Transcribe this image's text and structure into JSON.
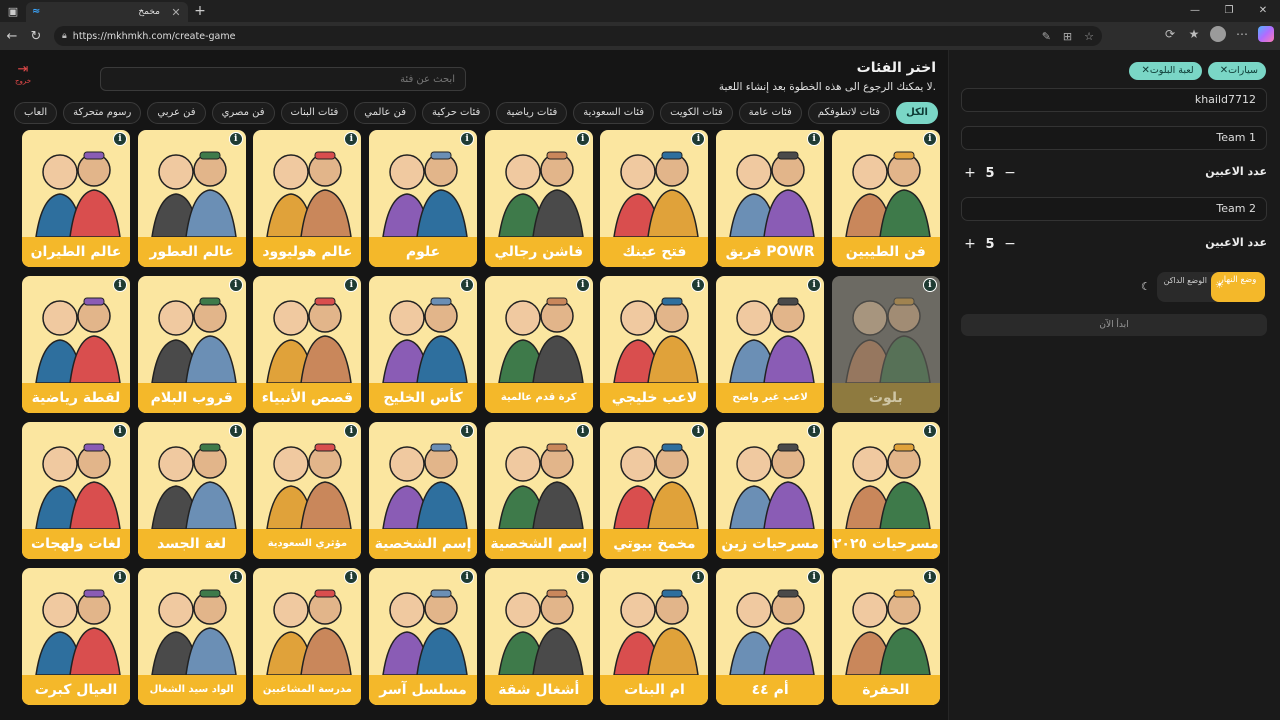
{
  "browser": {
    "tab_title": "مخمخ",
    "url": "https://mkhmkh.com/create-game",
    "minimize": "—",
    "maximize": "❐",
    "close": "✕",
    "new_tab": "+"
  },
  "main": {
    "exit_label": "خروج",
    "search_placeholder": "ابحث عن فئة",
    "title": "اختر الفئات",
    "subtitle": "لا يمكنك الرجوع الى هذه الخطوة بعد إنشاء اللعبة.",
    "chips": [
      {
        "label": "الكل",
        "active": true
      },
      {
        "label": "فئات لاتطوفكم",
        "active": false
      },
      {
        "label": "فئات عامة",
        "active": false
      },
      {
        "label": "فئات الكويت",
        "active": false
      },
      {
        "label": "فئات السعودية",
        "active": false
      },
      {
        "label": "فئات رياضية",
        "active": false
      },
      {
        "label": "فئات حركية",
        "active": false
      },
      {
        "label": "فن عالمي",
        "active": false
      },
      {
        "label": "فئات البنات",
        "active": false
      },
      {
        "label": "فن مصري",
        "active": false
      },
      {
        "label": "فن عربي",
        "active": false
      },
      {
        "label": "رسوم متحركة",
        "active": false
      },
      {
        "label": "العاب",
        "active": false
      }
    ],
    "cards": [
      {
        "label": "فن الطيبين",
        "icon": "two-men-portrait",
        "dim": false
      },
      {
        "label": "فريق POWR",
        "icon": "building-facade",
        "dim": false
      },
      {
        "label": "فتح عينك",
        "icon": "eye-periscope",
        "dim": false
      },
      {
        "label": "فاشن رجالي",
        "icon": "mens-fashion",
        "dim": false
      },
      {
        "label": "علوم",
        "icon": "microscope",
        "dim": false
      },
      {
        "label": "عالم هوليوود",
        "icon": "dancing-couple",
        "dim": false
      },
      {
        "label": "عالم العطور",
        "icon": "perfume-bottles",
        "dim": false
      },
      {
        "label": "عالم الطيران",
        "icon": "airplane-cockpit",
        "dim": false
      },
      {
        "label": "بلوت",
        "icon": "playing-cards",
        "dim": true
      },
      {
        "label": "لاعب غير واضح",
        "icon": "blurred-player",
        "dim": false,
        "small": true
      },
      {
        "label": "لاعب خليجي",
        "icon": "gulf-players",
        "dim": false
      },
      {
        "label": "كرة قدم عالمية",
        "icon": "world-cup-trophy",
        "dim": false,
        "small": true
      },
      {
        "label": "كأس الخليج",
        "icon": "gulf-cup-logo",
        "dim": false
      },
      {
        "label": "قصص الأنبياء",
        "icon": "open-book",
        "dim": false
      },
      {
        "label": "قروب البلام",
        "icon": "group-of-men",
        "dim": false
      },
      {
        "label": "لقطة رياضية",
        "icon": "football-field",
        "dim": false
      },
      {
        "label": "مسرحيات ٢٠٢٥",
        "icon": "theater-costumes",
        "dim": false
      },
      {
        "label": "مسرحيات زين",
        "icon": "theater-cast",
        "dim": false
      },
      {
        "label": "مخمخ بيوتي",
        "icon": "makeup-mirror",
        "dim": false
      },
      {
        "label": "إسم الشخصية",
        "icon": "mustache-man",
        "dim": false
      },
      {
        "label": "إسم الشخصية",
        "icon": "joker-spiderman",
        "dim": false
      },
      {
        "label": "مؤثري السعودية",
        "icon": "two-influencers",
        "dim": false,
        "small": true
      },
      {
        "label": "لغة الجسد",
        "icon": "two-women",
        "dim": false
      },
      {
        "label": "لغات ولهجات",
        "icon": "speech-bubbles",
        "dim": false
      },
      {
        "label": "الحفرة",
        "icon": "three-men",
        "dim": false
      },
      {
        "label": "أم ٤٤",
        "icon": "audience",
        "dim": false
      },
      {
        "label": "ام البنات",
        "icon": "women-group",
        "dim": false
      },
      {
        "label": "أشغال شقة",
        "icon": "couple-glasses",
        "dim": false
      },
      {
        "label": "مسلسل آسر",
        "icon": "couple-suit",
        "dim": false
      },
      {
        "label": "مدرسة المشاغبين",
        "icon": "students",
        "dim": false,
        "small": true
      },
      {
        "label": "الواد سيد الشغال",
        "icon": "laughing-man",
        "dim": false,
        "small": true
      },
      {
        "label": "العيال كبرت",
        "icon": "two-boys",
        "dim": false
      }
    ]
  },
  "side": {
    "tags": [
      {
        "label": "سيارات"
      },
      {
        "label": "لعبة البلوت"
      }
    ],
    "username": "khaild7712",
    "team1": "Team 1",
    "team2": "Team 2",
    "players_label": "عدد الاعبين",
    "players1": "5",
    "players2": "5",
    "plus": "+",
    "minus": "−",
    "day_mode": "وضع النهار",
    "night_mode": "الوضع الداكن",
    "start_button": "ابدأ الآن"
  },
  "colors": {
    "accent": "#7ad6c6",
    "card_bg": "#fbe6a0",
    "card_label": "#f4b82a",
    "exit": "#e34a4a"
  }
}
